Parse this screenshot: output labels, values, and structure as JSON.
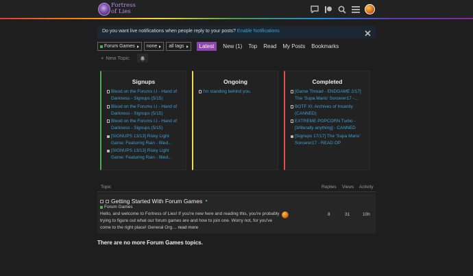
{
  "header": {
    "logo_text": "Fortress of Lies",
    "icons": [
      "chat-icon",
      "patreon-icon",
      "search-icon",
      "hamburger-menu-icon",
      "user-avatar"
    ]
  },
  "banner": {
    "text": "Do you want live notifications when people reply to your posts?",
    "link": "Enable Notifications"
  },
  "nav": {
    "category": "Forum Games",
    "sub": "none",
    "tags": "all tags",
    "tabs": [
      "Latest",
      "New (1)",
      "Top",
      "Read",
      "My Posts",
      "Bookmarks"
    ],
    "active_tab": "Latest"
  },
  "new_topic": "New Topic",
  "columns": [
    {
      "title": "Signups",
      "color": "#4caf50",
      "items": [
        {
          "text": "Blood on the Forums I.I - Hand of Darkness - Signups (5/15)",
          "icon": "pin"
        },
        {
          "text": "Blood on the Forums I.I - Hand of Darkness - Signups (5/15)",
          "icon": "pin"
        },
        {
          "text": "Blood on the Forums I.I - Hand of Darkness - Signups (5/15)",
          "icon": "pin"
        },
        {
          "text": "[SIGNUPS 13/13] Risky Light Game: Featuring Rain - filled...",
          "icon": "lock"
        },
        {
          "text": "[SIGNUPS 13/13] Risky Light Game: Featuring Rain - filled...",
          "icon": "lock"
        }
      ]
    },
    {
      "title": "Ongoing",
      "color": "#f1e140",
      "items": [
        {
          "text": "I'm standing behind you.",
          "icon": "pin"
        }
      ]
    },
    {
      "title": "Completed",
      "color": "#e05050",
      "items": [
        {
          "text": "[Game Thread - ENDGAME 2/17] The 'Supa Mario' Sorcerer17 -...",
          "icon": "pin"
        },
        {
          "text": "BOTF XI: Archives of Insanity (CANNED)",
          "icon": "pin"
        },
        {
          "text": "EXTREME POPCORN Turbo - [3/literally anything] - CANNED",
          "icon": "pin"
        },
        {
          "text": "[Signups 17/17] The 'Supa Mario' Sorcerer17 - READ OP",
          "icon": "lock"
        }
      ]
    }
  ],
  "table": {
    "headers": {
      "topic": "Topic",
      "replies": "Replies",
      "views": "Views",
      "activity": "Activity"
    },
    "rows": [
      {
        "title": "Getting Started With Forum Games",
        "category": "Forum Games",
        "excerpt": "Hello, and welcome to Fortress of Lies! If you're new here and reading this, you're probably trying to figure out what our forum games are and how to join one. Worry not, for you've come to the right place! General Org…",
        "read_more": "read more",
        "replies": "8",
        "views": "31",
        "activity": "10h"
      }
    ]
  },
  "no_more": "There are no more Forum Games topics."
}
